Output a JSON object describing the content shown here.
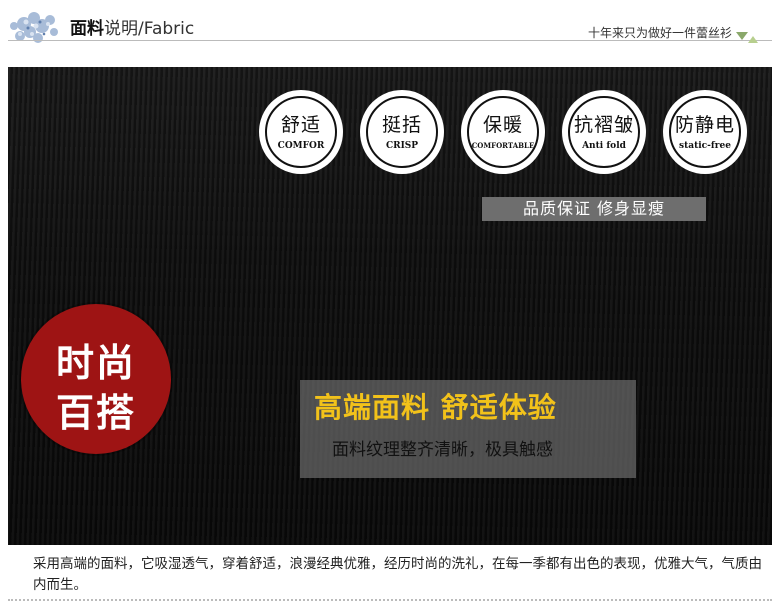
{
  "header": {
    "title_bold": "面料",
    "title_rest": "说明/Fabric",
    "slogan": "十年来只为做好一件蕾丝衫"
  },
  "features": [
    {
      "cn": "舒适",
      "en": "COMFOR"
    },
    {
      "cn": "挺括",
      "en": "CRISP"
    },
    {
      "cn": "保暖",
      "en": "COMFORTABLE"
    },
    {
      "cn": "抗褶皱",
      "en": "Anti fold"
    },
    {
      "cn": "防静电",
      "en": "static-free"
    }
  ],
  "quality_banner": "品质保证 修身显瘦",
  "badge": {
    "line1": "时尚",
    "line2": "百搭"
  },
  "promo": {
    "headline": "高端面料 舒适体验",
    "subline": "面料纹理整齐清晰，极具触感"
  },
  "description": "采用高端的面料，它吸湿透气，穿着舒适，浪漫经典优雅，经历时尚的洗礼，在每一季都有出色的表现，优雅大气，气质由内而生。",
  "colors": {
    "badge_red": "#9e1414",
    "headline_gold": "#f2c21a",
    "panel_black": "#0d0d0d"
  }
}
